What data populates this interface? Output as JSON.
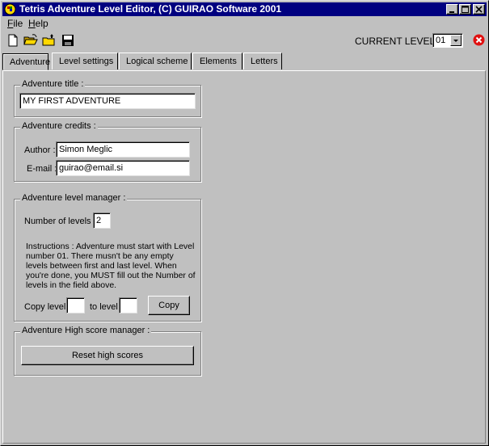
{
  "window": {
    "title": "Tetris Adventure Level Editor, (C) GUIRAO Software 2001"
  },
  "menu": [
    {
      "key": "F",
      "rest": "ile"
    },
    {
      "key": "H",
      "rest": "elp"
    }
  ],
  "toolbar": {
    "icons": [
      "new-file-icon",
      "open-folder-icon",
      "open-folder-up-icon",
      "save-disk-icon"
    ],
    "current_level_label": "CURRENT LEVEL :",
    "current_level_value": "01"
  },
  "tabs": [
    {
      "label": "Adventure",
      "active": true
    },
    {
      "label": "Level settings",
      "active": false
    },
    {
      "label": "Logical scheme",
      "active": false
    },
    {
      "label": "Elements",
      "active": false
    },
    {
      "label": "Letters",
      "active": false
    }
  ],
  "adventure": {
    "title_group": "Adventure title :",
    "title_value": "MY FIRST ADVENTURE",
    "credits_group": "Adventure credits :",
    "author_label": "Author :",
    "author_value": "Simon Meglic",
    "email_label": "E-mail :",
    "email_value": "guirao@email.si",
    "level_manager_group": "Adventure level manager :",
    "num_levels_label": "Number of levels :",
    "num_levels_value": "2",
    "instructions": "Instructions : Adventure must start with Level number 01. There musn't be any empty levels between first and last level. When you're done, you MUST fill out the Number of levels in the field above.",
    "copy_level_label": "Copy level",
    "to_level_label": "to level",
    "copy_from_value": "",
    "copy_to_value": "",
    "copy_button": "Copy",
    "highscore_group": "Adventure High score manager :",
    "reset_button": "Reset high scores"
  },
  "colors": {
    "face": "#c0c0c0",
    "titlebar": "#000080",
    "close_red": "#e01010"
  }
}
